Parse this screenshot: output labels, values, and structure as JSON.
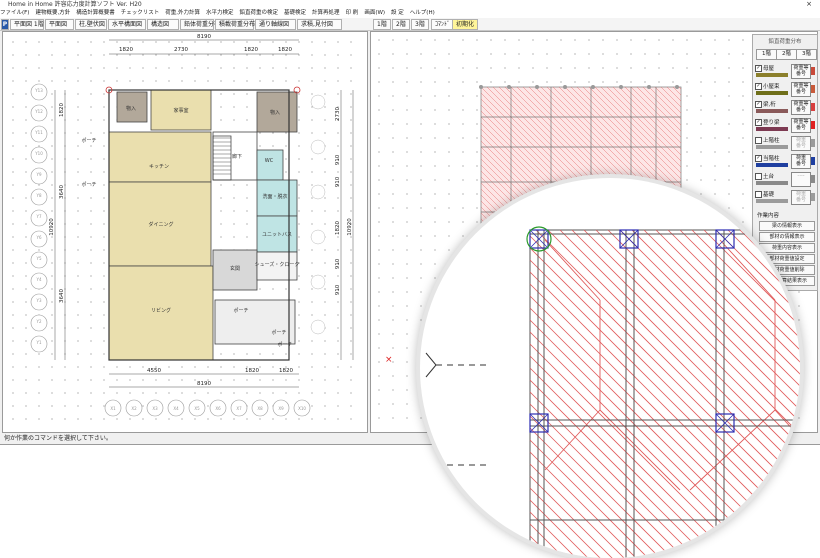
{
  "window": {
    "title": "Home in Home 許容応力度計算ソフト Ver. H20",
    "close_glyph": "×"
  },
  "menu": [
    "ファイル(F)",
    "建物概要,方針",
    "構造計算概要書",
    "チェックリスト",
    "荷重,外力計算",
    "水平力検定",
    "鉛直荷重の検定",
    "基礎検定",
    "計算再処理",
    "印 刷",
    "画面(W)",
    "設 定",
    "ヘルプ(H)"
  ],
  "toolbar": {
    "logo": "P",
    "buttons": [
      "平面図 1階",
      "平面図",
      "柱,壁伏図",
      "水平構面図",
      "構造図",
      "鉛体荷重分布",
      "積載荷重分布",
      "通り軸線図",
      "求積,見付図"
    ],
    "floor_tabs": [
      "1階",
      "2階",
      "3階"
    ],
    "command_btn": "ｺﾏﾝﾄﾞ",
    "initial_btn": "初期化"
  },
  "status": {
    "message": "何か作業のコマンドを選択して下さい。"
  },
  "plan": {
    "top_total": "8190",
    "top_dims": [
      "1820",
      "2730",
      "1820",
      "1820"
    ],
    "bottom_dims": [
      "4550",
      "1820",
      "1820"
    ],
    "bottom_total": "8190",
    "left_total": "10920",
    "left_dims": [
      "1820",
      "3640",
      "3640"
    ],
    "right_dims": [
      "2730",
      "910",
      "910",
      "1820",
      "910",
      "910"
    ],
    "right_total": "10920",
    "rooms": {
      "storage1": "物入",
      "kaji": "家事室",
      "storage2": "物入",
      "porch_top": "ポーチ",
      "porch_mid": "ポーチ",
      "hall": "廊下",
      "kitchen": "キッチン",
      "wc": "WC",
      "wash": "洗面・脱衣",
      "dining": "ダイニング",
      "bath": "ユニットバス",
      "genkan": "玄関",
      "shoes": "シューズ・クローク",
      "living": "リビング",
      "porch_low1": "ポーチ",
      "porch_low2": "ポーチ",
      "porch_low3": "ポーチ"
    },
    "x_labels": [
      "X1",
      "X2",
      "X3",
      "X4",
      "X5",
      "X6",
      "X7",
      "X8",
      "X9",
      "X10"
    ],
    "y_labels": [
      "Y1",
      "Y2",
      "Y3",
      "Y4",
      "Y5",
      "Y6",
      "Y7",
      "Y8",
      "Y9",
      "Y10",
      "Y11",
      "Y12",
      "Y13"
    ]
  },
  "side_panel": {
    "caption": "鉛直荷重分布",
    "floors": [
      "1階",
      "2階",
      "3階"
    ],
    "layers": [
      {
        "name": "母屋",
        "checked": true,
        "btn": "荷重等",
        "btn2": "番号",
        "color": "#8b7f2b",
        "end": "#c84a3a"
      },
      {
        "name": "小屋束",
        "checked": true,
        "btn": "荷重等",
        "btn2": "番号",
        "color": "#6f6f1a",
        "end": "#c85a3a"
      },
      {
        "name": "梁,桁",
        "checked": true,
        "btn": "荷重等",
        "btn2": "番号",
        "color": "#8a5a5a",
        "end": "#d84040"
      },
      {
        "name": "登り梁",
        "checked": true,
        "btn": "荷重等",
        "btn2": "番号",
        "color": "#7d3a52",
        "end": "#e02020"
      },
      {
        "name": "上階柱",
        "checked": false,
        "btn": "荷重",
        "btn2": "番号",
        "color": "#9a9a9a",
        "end": "#9a9a9a"
      },
      {
        "name": "当階柱",
        "checked": true,
        "btn": "荷重",
        "btn2": "番号",
        "color": "#1f3fa0",
        "end": "#1f3fa0"
      },
      {
        "name": "土台",
        "checked": false,
        "btn": "----",
        "btn2": "",
        "color": "#8a8a8a",
        "end": "#8a8a8a"
      },
      {
        "name": "基礎",
        "checked": false,
        "btn": "荷重",
        "btn2": "番号",
        "color": "#9b9b9b",
        "end": "#9b9b9b"
      }
    ],
    "action_title": "作業内容",
    "actions": [
      "梁の情報表示",
      "部材の情報表示",
      "荷重内容表示",
      "部材荷重値設定",
      "部材荷重値削除",
      "部材計算結果表示"
    ]
  },
  "colors": {
    "room_tan": "#eadfae",
    "room_gray": "#d8d8d8",
    "room_blue": "#bfe4e4",
    "room_brown": "#b2a89a",
    "hatch": "#e05a5a",
    "column": "#2b2bb0",
    "grid_dot": "#888888"
  }
}
